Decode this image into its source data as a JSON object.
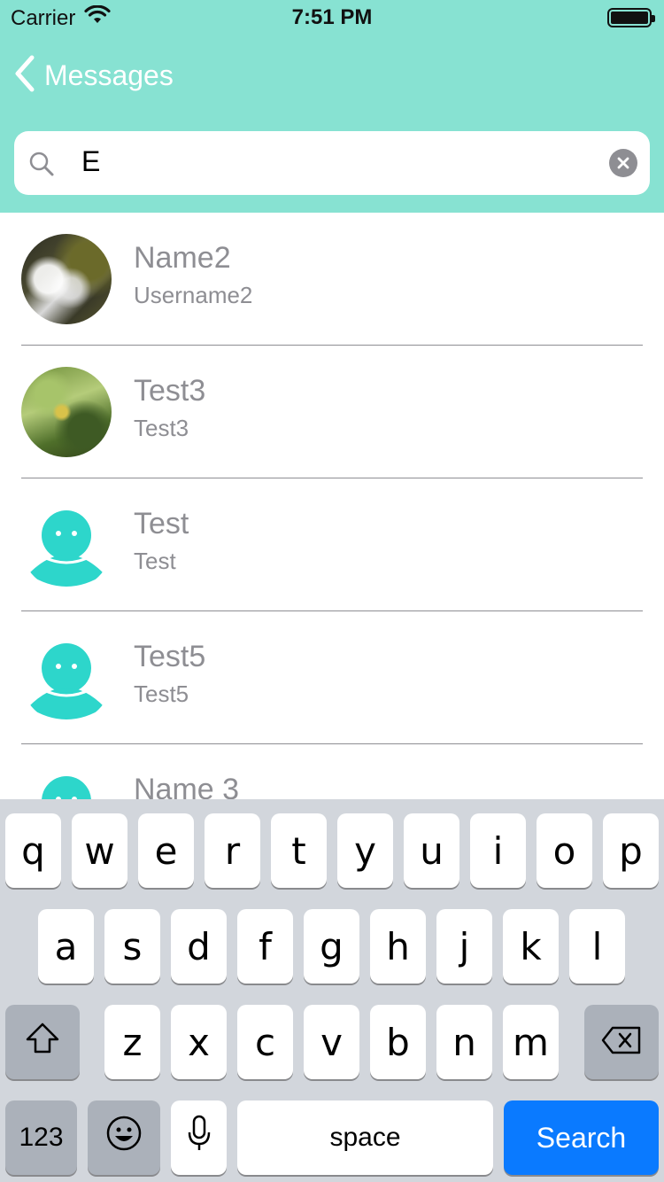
{
  "status_bar": {
    "carrier": "Carrier",
    "time": "7:51 PM"
  },
  "nav": {
    "back_label": "Messages"
  },
  "search": {
    "value": "E"
  },
  "contacts": [
    {
      "name": "Name2",
      "username": "Username2",
      "avatar": "photo-waterfall"
    },
    {
      "name": "Test3",
      "username": "Test3",
      "avatar": "photo-leaves"
    },
    {
      "name": "Test",
      "username": "Test",
      "avatar": "default-person"
    },
    {
      "name": "Test5",
      "username": "Test5",
      "avatar": "default-person"
    },
    {
      "name": "Name 3",
      "username": "",
      "avatar": "default-person"
    }
  ],
  "keyboard": {
    "row1": [
      "q",
      "w",
      "e",
      "r",
      "t",
      "y",
      "u",
      "i",
      "o",
      "p"
    ],
    "row2": [
      "a",
      "s",
      "d",
      "f",
      "g",
      "h",
      "j",
      "k",
      "l"
    ],
    "row3": [
      "z",
      "x",
      "c",
      "v",
      "b",
      "n",
      "m"
    ],
    "numbers_label": "123",
    "space_label": "space",
    "search_label": "Search"
  },
  "colors": {
    "header": "#87E2D2",
    "accent_avatar": "#2DD6CB",
    "keyboard_bg": "#D2D6DC",
    "search_key": "#0A7AFF"
  }
}
